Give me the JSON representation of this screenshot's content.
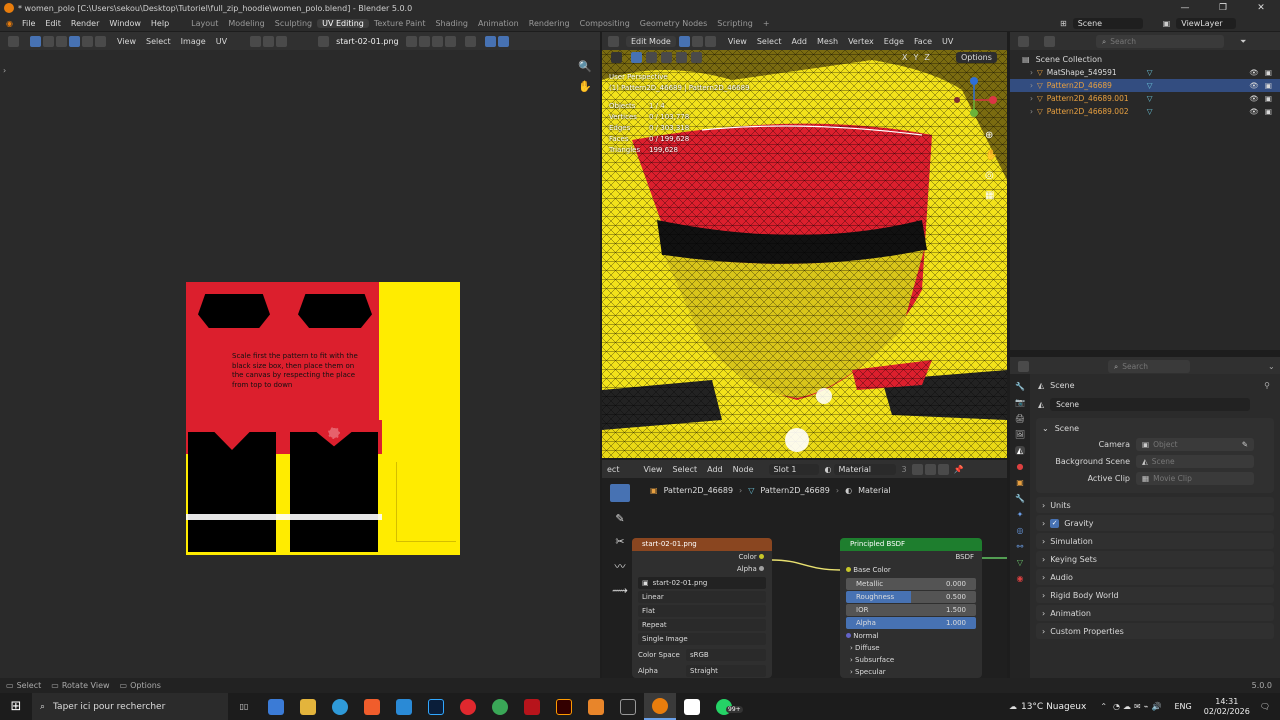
{
  "window": {
    "title": "* women_polo [C:\\Users\\sekou\\Desktop\\Tutoriel\\full_zip_hoodie\\women_polo.blend] - Blender 5.0.0",
    "controls": [
      "—",
      "❐",
      "✕"
    ]
  },
  "menu": {
    "items": [
      "File",
      "Edit",
      "Render",
      "Window",
      "Help"
    ],
    "workspaces": [
      "Layout",
      "Modeling",
      "Sculpting",
      "UV Editing",
      "Texture Paint",
      "Shading",
      "Animation",
      "Rendering",
      "Compositing",
      "Geometry Nodes",
      "Scripting"
    ],
    "add": "+",
    "scene": "Scene",
    "view_layer": "ViewLayer"
  },
  "uv_header": {
    "items": [
      "View",
      "Select",
      "Image",
      "UV"
    ],
    "image": "start-02-01.png"
  },
  "uv_canvas": {
    "instructions": "Scale first the pattern to fit with the black size box, then place them on the canvas by respecting the place from top to down"
  },
  "viewport_header": {
    "mode": "Edit Mode",
    "items": [
      "View",
      "Select",
      "Add",
      "Mesh",
      "Vertex",
      "Edge",
      "Face",
      "UV"
    ],
    "axes": [
      "X",
      "Y",
      "Z"
    ],
    "options": "Options"
  },
  "viewport_info": {
    "perspective": "User Perspective",
    "object": "(1) Pattern2D_46689 | Pattern2D_46689",
    "stats": [
      {
        "label": "Objects",
        "value": "1 / 4"
      },
      {
        "label": "Vertices",
        "value": "0 / 103,778"
      },
      {
        "label": "Edges",
        "value": "0 / 303,318"
      },
      {
        "label": "Faces",
        "value": "0 / 199,628"
      },
      {
        "label": "Triangles",
        "value": "199,628"
      }
    ]
  },
  "node_header": {
    "items": [
      "ect",
      "View",
      "Select",
      "Add",
      "Node"
    ],
    "slot": "Slot 1",
    "material": "Material",
    "users": "3"
  },
  "node_breadcrumb": [
    "Pattern2D_46689",
    "Pattern2D_46689",
    "Material"
  ],
  "image_node": {
    "title": "start-02-01.png",
    "outputs": [
      "Color",
      "Alpha"
    ],
    "image": "start-02-01.png",
    "interpolation": "Linear",
    "projection": "Flat",
    "extension": "Repeat",
    "source": "Single Image",
    "color_space_label": "Color Space",
    "color_space": "sRGB",
    "alpha_label": "Alpha",
    "alpha": "Straight"
  },
  "bsdf_node": {
    "title": "Principled BSDF",
    "output": "BSDF",
    "base_color": "Base Color",
    "params": [
      {
        "label": "Metallic",
        "value": "0.000",
        "fill": 0
      },
      {
        "label": "Roughness",
        "value": "0.500",
        "fill": 0.5
      },
      {
        "label": "IOR",
        "value": "1.500",
        "fill": 0
      },
      {
        "label": "Alpha",
        "value": "1.000",
        "fill": 1
      }
    ],
    "normal": "Normal",
    "panels": [
      "Diffuse",
      "Subsurface",
      "Specular"
    ]
  },
  "outliner": {
    "search_placeholder": "Search",
    "collection": "Scene Collection",
    "items": [
      {
        "name": "MatShape_549591",
        "selected": false
      },
      {
        "name": "Pattern2D_46689",
        "selected": true
      },
      {
        "name": "Pattern2D_46689.001",
        "selected": false
      },
      {
        "name": "Pattern2D_46689.002",
        "selected": false
      }
    ]
  },
  "properties": {
    "search_placeholder": "Search",
    "context": "Scene",
    "scene_name": "Scene",
    "section": "Scene",
    "camera_label": "Camera",
    "camera_placeholder": "Object",
    "bg_scene_label": "Background Scene",
    "bg_scene_placeholder": "Scene",
    "active_clip_label": "Active Clip",
    "active_clip_placeholder": "Movie Clip",
    "panels": [
      {
        "label": "Units",
        "checkbox": false
      },
      {
        "label": "Gravity",
        "checkbox": true
      },
      {
        "label": "Simulation",
        "checkbox": false
      },
      {
        "label": "Keying Sets",
        "checkbox": false
      },
      {
        "label": "Audio",
        "checkbox": false
      },
      {
        "label": "Rigid Body World",
        "checkbox": false
      },
      {
        "label": "Animation",
        "checkbox": false
      },
      {
        "label": "Custom Properties",
        "checkbox": false
      }
    ]
  },
  "statusbar": {
    "select": "Select",
    "rotate": "Rotate View",
    "options": "Options",
    "version": "5.0.0"
  },
  "taskbar": {
    "search": "Taper ici pour rechercher",
    "weather": "13°C Nuageux",
    "lang": "ENG",
    "time": "14:31",
    "date": "02/02/2026",
    "badge": "99+"
  },
  "colors": {
    "accent": "#4772b3",
    "shirt_red": "#dc1f2d",
    "shirt_yellow": "#ffec00",
    "node_image": "#8a4620",
    "node_bsdf": "#1e7e2e"
  }
}
